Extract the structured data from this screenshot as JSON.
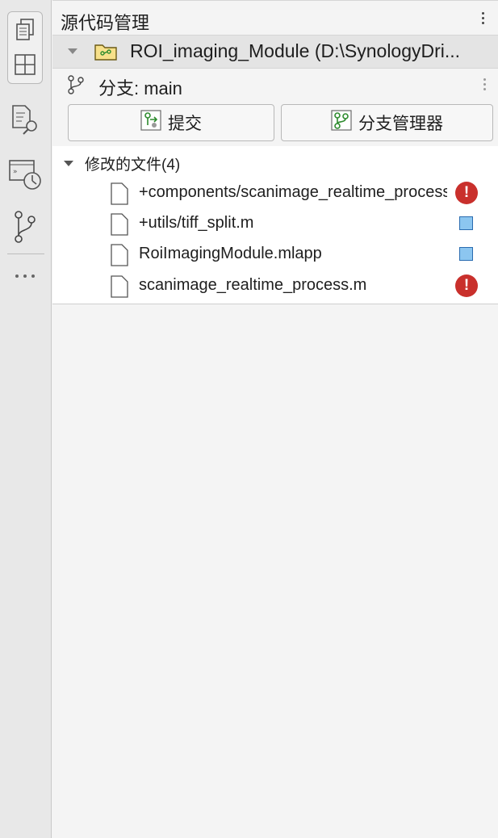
{
  "activity_bar": {
    "icons": [
      "documents-icon",
      "layout-icon",
      "find-files-icon",
      "history-icon",
      "source-control-icon",
      "more-icon"
    ]
  },
  "panel": {
    "title": "源代码管理",
    "repository": "ROI_imaging_Module (D:\\SynologyDri...",
    "branch_label": "分支: main",
    "buttons": {
      "commit": "提交",
      "branch_manager": "分支管理器"
    },
    "files": {
      "header": "修改的文件(4)",
      "items": [
        {
          "name": "+components/scanimage_realtime_process.m",
          "status": "conflict"
        },
        {
          "name": "+utils/tiff_split.m",
          "status": "modified"
        },
        {
          "name": "RoiImagingModule.mlapp",
          "status": "modified"
        },
        {
          "name": "scanimage_realtime_process.m",
          "status": "conflict"
        }
      ]
    }
  },
  "colors": {
    "conflict": "#c9302c",
    "modified": "#8cc6f0",
    "accent_green": "#2e8b2e"
  }
}
